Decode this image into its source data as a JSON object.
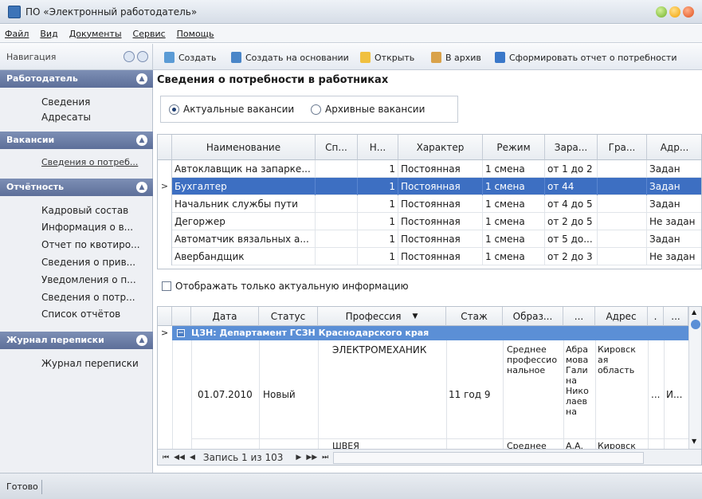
{
  "window": {
    "title": "ПО «Электронный работодатель»"
  },
  "menu": [
    "Файл",
    "Вид",
    "Документы",
    "Сервис",
    "Помощь"
  ],
  "toolbar": {
    "nav_label": "Навигация",
    "buttons": [
      "Создать",
      "Создать на основании",
      "Открыть",
      "В архив",
      "Сформировать отчет о потребности"
    ]
  },
  "sidebar": {
    "sections": [
      {
        "title": "Работодатель",
        "items": [
          "Сведения",
          "Адресаты"
        ]
      },
      {
        "title": "Вакансии",
        "items": [
          "Сведения о потреб..."
        ]
      },
      {
        "title": "Отчётность",
        "items": [
          "Кадровый состав",
          "Информация о в...",
          "Отчет по квотиро...",
          "Сведения о прив...",
          "Уведомления о п...",
          "Сведения о потр...",
          "Список отчётов"
        ]
      },
      {
        "title": "Журнал переписки",
        "items": [
          "Журнал переписки"
        ]
      }
    ]
  },
  "main": {
    "title": "Сведения о потребности в работниках",
    "radios": [
      "Актуальные вакансии",
      "Архивные вакансии"
    ],
    "grid1": {
      "headers": [
        "Наименование",
        "Сп...",
        "Н...",
        "Характер",
        "Режим",
        "Зара...",
        "Гра...",
        "Адр..."
      ],
      "rows": [
        [
          "Автоклавщик на запарке...",
          "",
          "1",
          "Постоянная",
          "1 смена",
          "от 1 до 2",
          "",
          "Задан"
        ],
        [
          "Бухгалтер",
          "",
          "1",
          "Постоянная",
          "1 смена",
          "от 44",
          "",
          "Задан"
        ],
        [
          "Начальник службы пути",
          "",
          "1",
          "Постоянная",
          "1 смена",
          "от 4 до 5",
          "",
          "Задан"
        ],
        [
          "Дегоржер",
          "",
          "1",
          "Постоянная",
          "1 смена",
          "от 2 до 5",
          "",
          "Не задан"
        ],
        [
          "Автоматчик вязальных а...",
          "",
          "1",
          "Постоянная",
          "1 смена",
          "от 5 до...",
          "",
          "Задан"
        ],
        [
          "Авербандщик",
          "",
          "1",
          "Постоянная",
          "1 смена",
          "от 2 до 3",
          "",
          "Не задан"
        ]
      ],
      "selected_row": 1
    },
    "checkbox_label": "Отображать только актуальную информацию",
    "grid2": {
      "headers": [
        "Дата",
        "Статус",
        "Профессия",
        "Стаж",
        "Образ...",
        "...",
        "Адрес",
        ".",
        "..."
      ],
      "group": "ЦЗН: Департамент ГСЗН Краснодарского края",
      "row": {
        "date": "01.07.2010",
        "status": "Новый",
        "profession": "ЭЛЕКТРОМЕХАНИК",
        "experience": "11 год 9",
        "education": [
          "Среднее",
          "профессио",
          "нальное"
        ],
        "name": [
          "Абра",
          "мова",
          "Гали",
          "на",
          "Нико",
          "лаев",
          "на"
        ],
        "address": [
          "Кировск",
          "ая",
          "область"
        ],
        "c8": "...",
        "c9": "И..."
      },
      "partial_row": {
        "profession": "ШВЕЯ",
        "education": "Среднее",
        "name": "А.А.",
        "address": "Кировск"
      },
      "pager": "Запись 1 из 103"
    }
  },
  "status": "Готово"
}
